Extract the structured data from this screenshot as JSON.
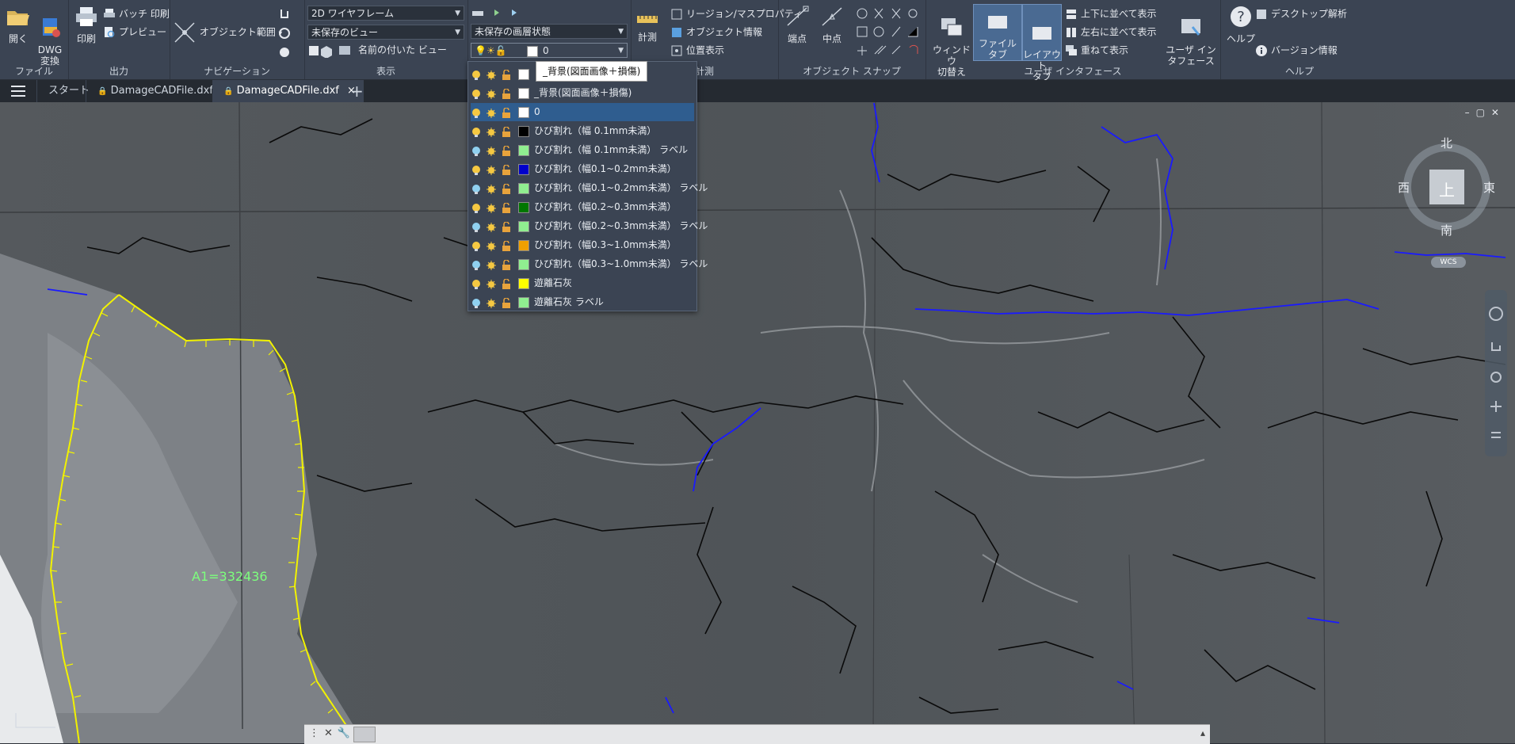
{
  "ribbon": {
    "file": {
      "title": "ファイル",
      "open": "開く",
      "dwg_convert": "DWG\n変換"
    },
    "output": {
      "title": "出力",
      "print": "印刷",
      "batch_print": "バッチ 印刷",
      "preview": "プレビュー"
    },
    "navigation": {
      "title": "ナビゲーション",
      "object_range": "オブジェクト範囲"
    },
    "view": {
      "title": "表示",
      "visual_style": "2D ワイヤフレーム",
      "unsaved_view": "未保存のビュー",
      "named_view": "名前の付いた ビュー"
    },
    "layers": {
      "state": "未保存の画層状態",
      "current_layer": "0"
    },
    "measure": {
      "title": "計測",
      "measure_btn": "計測",
      "region_mass": "リージョン/マスプロパティ",
      "object_info": "オブジェクト情報",
      "location": "位置表示"
    },
    "snap": {
      "title": "オブジェクト スナップ",
      "endpoint": "端点",
      "midpoint": "中点"
    },
    "ui": {
      "title": "ユーザ インタフェース",
      "switch_window": "ウィンドウ\n切替え",
      "file_tab": "ファイル タブ",
      "layout_tab": "レイアウト\nタブ",
      "tile_horizontal": "上下に並べて表示",
      "tile_vertical": "左右に並べて表示",
      "cascade": "重ねて表示",
      "user_interface": "ユーザ イン\nタフェース"
    },
    "help": {
      "title": "ヘルプ",
      "help": "ヘルプ",
      "desktop_analysis": "デスクトップ解析",
      "version": "バージョン情報"
    }
  },
  "tabs": {
    "start": "スタート",
    "file1": "DamageCADFile.dxf",
    "file2": "DamageCADFile.dxf",
    "close": "×",
    "add": "+"
  },
  "tooltip": "_背景(図面画像＋損傷)",
  "layers_list": [
    {
      "name": "_背景(図面画像＋損傷)",
      "color": "#ffffff",
      "selected": false
    },
    {
      "name": "0",
      "color": "#ffffff",
      "selected": true
    },
    {
      "name": "ひび割れ（幅 0.1mm未満）",
      "color": "#000000",
      "selected": false
    },
    {
      "name": "ひび割れ（幅 0.1mm未満） ラベル",
      "color": "#90ee90",
      "selected": false
    },
    {
      "name": "ひび割れ（幅0.1~0.2mm未満）",
      "color": "#0000cc",
      "selected": false
    },
    {
      "name": "ひび割れ（幅0.1~0.2mm未満） ラベル",
      "color": "#90ee90",
      "selected": false
    },
    {
      "name": "ひび割れ（幅0.2~0.3mm未満）",
      "color": "#007700",
      "selected": false
    },
    {
      "name": "ひび割れ（幅0.2~0.3mm未満） ラベル",
      "color": "#90ee90",
      "selected": false
    },
    {
      "name": "ひび割れ（幅0.3~1.0mm未満）",
      "color": "#f0a000",
      "selected": false
    },
    {
      "name": "ひび割れ（幅0.3~1.0mm未満） ラベル",
      "color": "#90ee90",
      "selected": false
    },
    {
      "name": "遊離石灰",
      "color": "#ffff00",
      "selected": false
    },
    {
      "name": "遊離石灰 ラベル",
      "color": "#90ee90",
      "selected": false
    }
  ],
  "drawing": {
    "area_label": "A1=332436"
  },
  "navcube": {
    "north": "北",
    "south": "南",
    "east": "東",
    "west": "西",
    "top": "上",
    "wcs": "WCS"
  },
  "colors": {
    "crack_blue": "#1a1aff",
    "crack_black": "#0a0a0a",
    "efflorescence": "#f2f200",
    "label_green": "#7dff7d"
  }
}
